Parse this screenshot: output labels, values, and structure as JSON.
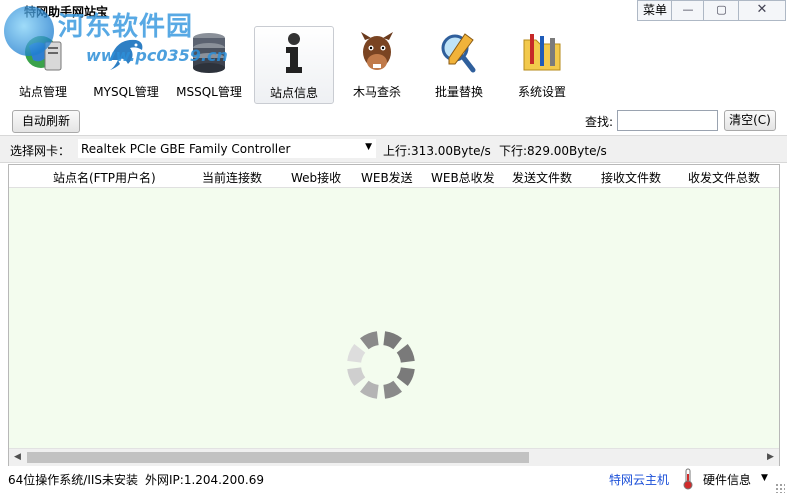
{
  "window": {
    "title": "特网助手网站宝",
    "menu_label": "菜单",
    "minimize_icon": "—",
    "maximize_icon": "▢",
    "close_icon": "✕"
  },
  "watermark": {
    "text": "河东软件园",
    "url": "www.pc0359.cn"
  },
  "toolbar": {
    "items": [
      {
        "label": "站点管理",
        "icon": "server-globe-icon"
      },
      {
        "label": "MYSQL管理",
        "icon": "dolphin-icon"
      },
      {
        "label": "MSSQL管理",
        "icon": "database-icon"
      },
      {
        "label": "站点信息",
        "icon": "info-icon",
        "active": true
      },
      {
        "label": "木马查杀",
        "icon": "horse-icon"
      },
      {
        "label": "批量替换",
        "icon": "magnifier-pencil-icon"
      },
      {
        "label": "系统设置",
        "icon": "tools-folder-icon"
      }
    ]
  },
  "controls": {
    "refresh_label": "自动刷新",
    "search_label": "查找:",
    "search_value": "",
    "clear_label": "清空(C)"
  },
  "nic": {
    "label": "选择网卡：",
    "selected": "Realtek PCIe GBE Family Controller",
    "upload": "上行:313.00Byte/s",
    "download": "下行:829.00Byte/s"
  },
  "table": {
    "columns": [
      "站点名(FTP用户名)",
      "当前连接数",
      "Web接收",
      "WEB发送",
      "WEB总收发",
      "发送文件数",
      "接收文件数",
      "收发文件总数"
    ],
    "rows": []
  },
  "status": {
    "os": "64位操作系统/IIS未安装",
    "external_ip": "外网IP:1.204.200.69",
    "cloud_link": "特网云主机",
    "hardware": "硬件信息"
  },
  "colors": {
    "table_bg": "#f3fcee",
    "link": "#1a4fd8",
    "spinner": "#7a7a7a"
  }
}
